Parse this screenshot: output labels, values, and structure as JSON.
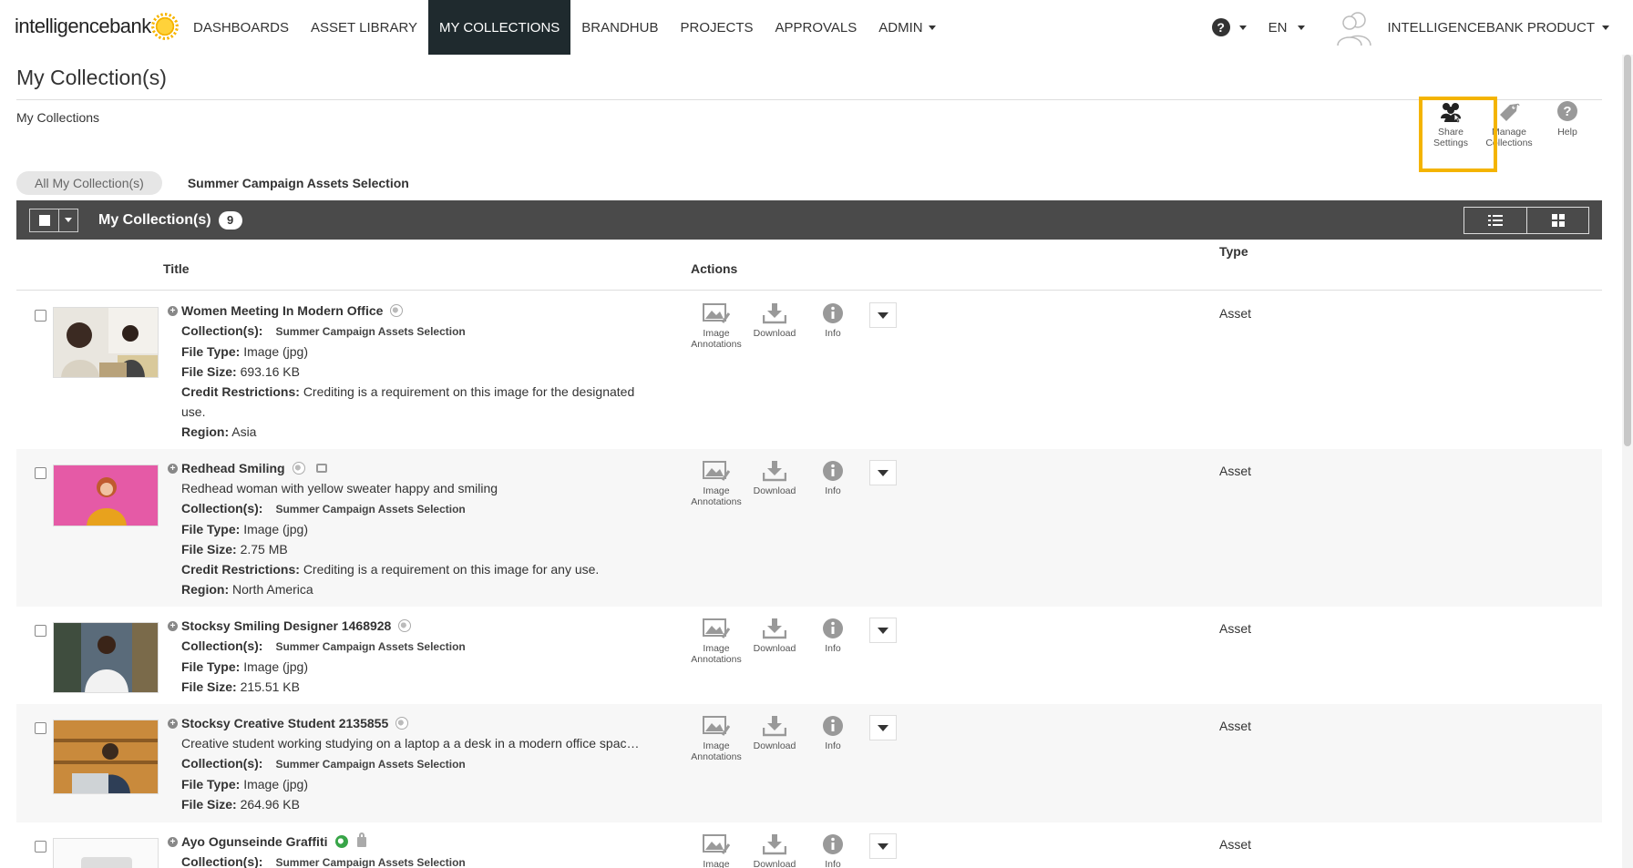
{
  "app": {
    "logo_text": "intelligencebank",
    "nav": [
      {
        "label": "DASHBOARDS"
      },
      {
        "label": "ASSET LIBRARY"
      },
      {
        "label": "MY COLLECTIONS",
        "active": true
      },
      {
        "label": "BRANDHUB"
      },
      {
        "label": "PROJECTS"
      },
      {
        "label": "APPROVALS"
      },
      {
        "label": "ADMIN"
      }
    ],
    "help_glyph": "?",
    "language": "EN",
    "user_name": "INTELLIGENCEBANK PRODUCT"
  },
  "page": {
    "title": "My Collection(s)",
    "breadcrumb": "My Collections"
  },
  "toolbar": {
    "share_label": "Share Settings",
    "manage_label": "Manage Collections",
    "help_label": "Help",
    "highlight_color": "#f4b400"
  },
  "tabs": [
    {
      "label": "All My Collection(s)"
    },
    {
      "label": "Summer Campaign Assets Selection"
    }
  ],
  "bar": {
    "title": "My Collection(s)",
    "count": "9"
  },
  "table": {
    "col_title": "Title",
    "col_actions": "Actions",
    "col_type": "Type"
  },
  "labels": {
    "collections": "Collection(s):",
    "file_type": "File Type:",
    "file_size": "File Size:",
    "credit": "Credit Restrictions:",
    "region": "Region:",
    "image_annotations": "Image Annotations",
    "download": "Download",
    "info": "Info"
  },
  "rows": [
    {
      "title": "Women Meeting In Modern Office",
      "collection": "Summer Campaign Assets Selection",
      "file_type": "Image (jpg)",
      "file_size": "693.16 KB",
      "credit": "Crediting is a requirement on this image for the designated use.",
      "region": "Asia",
      "type": "Asset"
    },
    {
      "title": "Redhead Smiling",
      "description": "Redhead woman with yellow sweater happy and smiling",
      "collection": "Summer Campaign Assets Selection",
      "file_type": "Image (jpg)",
      "file_size": "2.75 MB",
      "credit": "Crediting is a requirement on this image for any use.",
      "region": "North America",
      "type": "Asset"
    },
    {
      "title": "Stocksy Smiling Designer 1468928",
      "collection": "Summer Campaign Assets Selection",
      "file_type": "Image (jpg)",
      "file_size": "215.51 KB",
      "type": "Asset"
    },
    {
      "title": "Stocksy Creative Student 2135855",
      "description": "Creative student working studying on a laptop a a desk in a modern office spac…",
      "collection": "Summer Campaign Assets Selection",
      "file_type": "Image (jpg)",
      "file_size": "264.96 KB",
      "type": "Asset"
    },
    {
      "title": "Ayo Ogunseinde Graffiti",
      "collection": "Summer Campaign Assets Selection",
      "type": "Asset"
    }
  ]
}
